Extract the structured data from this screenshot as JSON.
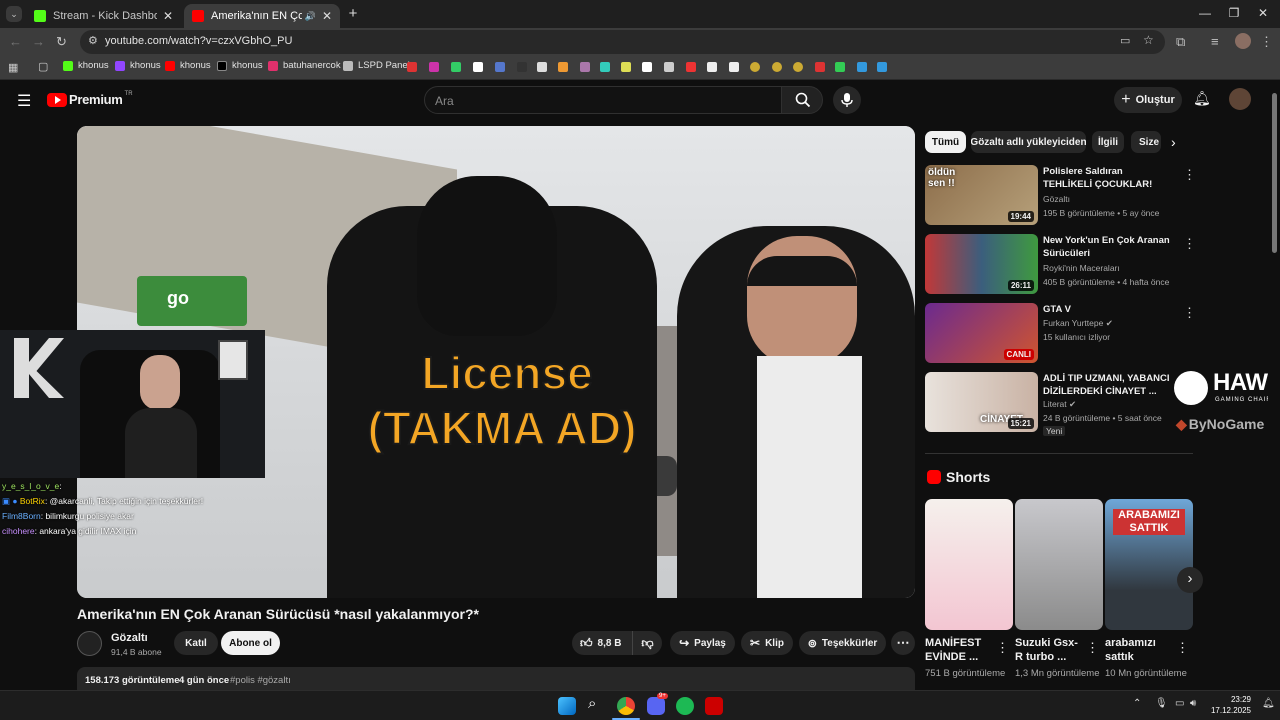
{
  "browser": {
    "tabs": [
      {
        "title": "Stream - Kick Dashboard",
        "active": false,
        "favicon_color": "#53fc18"
      },
      {
        "title": "Amerika'nın EN Çok Aranan",
        "active": true,
        "favicon_color": "#ff0000"
      }
    ],
    "new_tab_label": "+",
    "url": "youtube.com/watch?v=czxVGbhO_PU",
    "bookmarks": [
      {
        "label": "khonus",
        "color": "#53fc18"
      },
      {
        "label": "khonus",
        "color": "#9146ff"
      },
      {
        "label": "khonus",
        "color": "#ff0000"
      },
      {
        "label": "khonus",
        "color": "#000000"
      },
      {
        "label": "batuhanercok",
        "color": "#e1306c"
      },
      {
        "label": "LSPD Panel",
        "color": "#bbbbbb"
      }
    ]
  },
  "youtube": {
    "logo_text": "Premium",
    "logo_sup": "TR",
    "search_placeholder": "Ara",
    "create_label": "Oluştur"
  },
  "video": {
    "overlay_line1": "License",
    "overlay_line2": "(TAKMA AD)",
    "title": "Amerika'nın EN Çok Aranan Sürücüsü *nasıl yakalanmıyor?*",
    "channel": "Gözaltı",
    "subscribers": "91,4 B abone",
    "join_label": "Katıl",
    "subscribe_label": "Abone ol",
    "likes": "8,8 B",
    "share_label": "Paylaş",
    "clip_label": "Klip",
    "thanks_label": "Teşekkürler",
    "views": "158.173 görüntüleme",
    "age": "4 gün önce",
    "tags": "#polis #gözaltı"
  },
  "stream_overlay": {
    "chat": [
      {
        "user": "y_e_s_l_o_v_e",
        "text": ":",
        "color": "#9ee35f"
      },
      {
        "user": "BotRix",
        "text": ": @akarcanli, Takip ettiğin için teşekkürler!",
        "color": "#ffd400"
      },
      {
        "user": "Film8Born",
        "text": ": bilimkurgu polisiye akar",
        "color": "#6ab0ff"
      },
      {
        "user": "cihohere",
        "text": ": ankara'ya gidilir IMAX için",
        "color": "#c890ff"
      }
    ],
    "sponsor_brand": "HAWK",
    "sponsor_sub": "GAMING CHAIR",
    "sponsor_partner": "ByNoGame"
  },
  "sidebar": {
    "chips": [
      "Tümü",
      "Gözaltı adlı yükleyiciden",
      "İlgili",
      "Size"
    ],
    "recommendations": [
      {
        "title": "Polislere Saldıran TEHLİKELİ ÇOCUKLAR!",
        "channel": "Gözaltı",
        "meta": "195 B görüntüleme • 5 ay önce",
        "duration": "19:44",
        "thumb_text": "öldün sen !!"
      },
      {
        "title": "New York'un En Çok Aranan Sürücüleri",
        "channel": "Royki'nin Maceraları",
        "meta": "405 B görüntüleme • 4 hafta önce",
        "duration": "26:11"
      },
      {
        "title": "GTA V",
        "channel": "Furkan Yurttepe",
        "meta": "15 kullanıcı izliyor",
        "duration": "CANLI"
      },
      {
        "title": "ADLİ TIP UZMANI, YABANCI DİZİLERDEKİ CİNAYET ...",
        "channel": "Literat",
        "meta": "24 B görüntüleme • 5 saat önce",
        "duration": "15:21",
        "badge": "Yeni",
        "thumb_text": "CİNAYET"
      }
    ],
    "shorts_title": "Shorts",
    "shorts": [
      {
        "title": "MANİFEST EVİNDE ...",
        "views": "751 B görüntüleme"
      },
      {
        "title": "Suzuki Gsx-R turbo ...",
        "views": "1,3 Mn görüntüleme"
      },
      {
        "title": "arabamızı sattık",
        "views": "10 Mn görüntüleme",
        "thumb_text": "ARABAMIZI SATTIK"
      }
    ]
  },
  "taskbar": {
    "time": "23:29",
    "date": "17.12.2025",
    "discord_badge": "9+"
  }
}
